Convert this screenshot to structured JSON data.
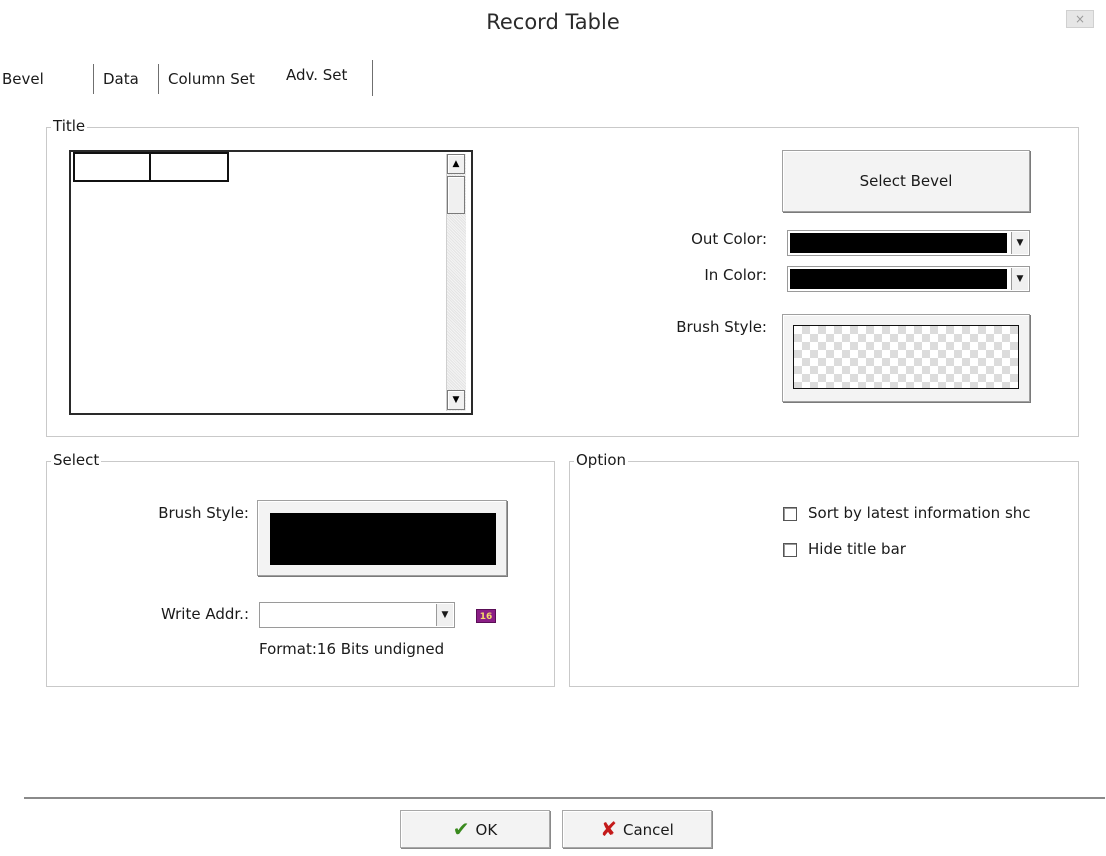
{
  "window": {
    "title": "Record Table",
    "close_glyph": "×"
  },
  "tabs": [
    {
      "label": "Bevel",
      "active": false
    },
    {
      "label": "Data",
      "active": false
    },
    {
      "label": "Column Set",
      "active": false
    },
    {
      "label": "Adv. Set",
      "active": true
    }
  ],
  "title_group": {
    "legend": "Title",
    "select_bevel_label": "Select Bevel",
    "out_color_label": "Out Color:",
    "in_color_label": "In Color:",
    "brush_style_label": "Brush Style:",
    "out_color": "#000000",
    "in_color": "#000000"
  },
  "select_group": {
    "legend": "Select",
    "brush_style_label": "Brush Style:",
    "brush_color": "#000000",
    "write_addr_label": "Write Addr.:",
    "write_addr_value": "",
    "badge_text": "16",
    "format_text": "Format:16 Bits undigned"
  },
  "option_group": {
    "legend": "Option",
    "checkboxes": [
      {
        "label": "Sort by latest information shc",
        "checked": false
      },
      {
        "label": "Hide title bar",
        "checked": false
      }
    ]
  },
  "footer": {
    "ok_label": "OK",
    "cancel_label": "Cancel"
  },
  "icons": {
    "ok": "check-icon",
    "cancel": "x-icon",
    "scroll_up": "arrow-up-icon",
    "scroll_down": "arrow-down-icon",
    "dropdown": "chevron-down-icon"
  }
}
